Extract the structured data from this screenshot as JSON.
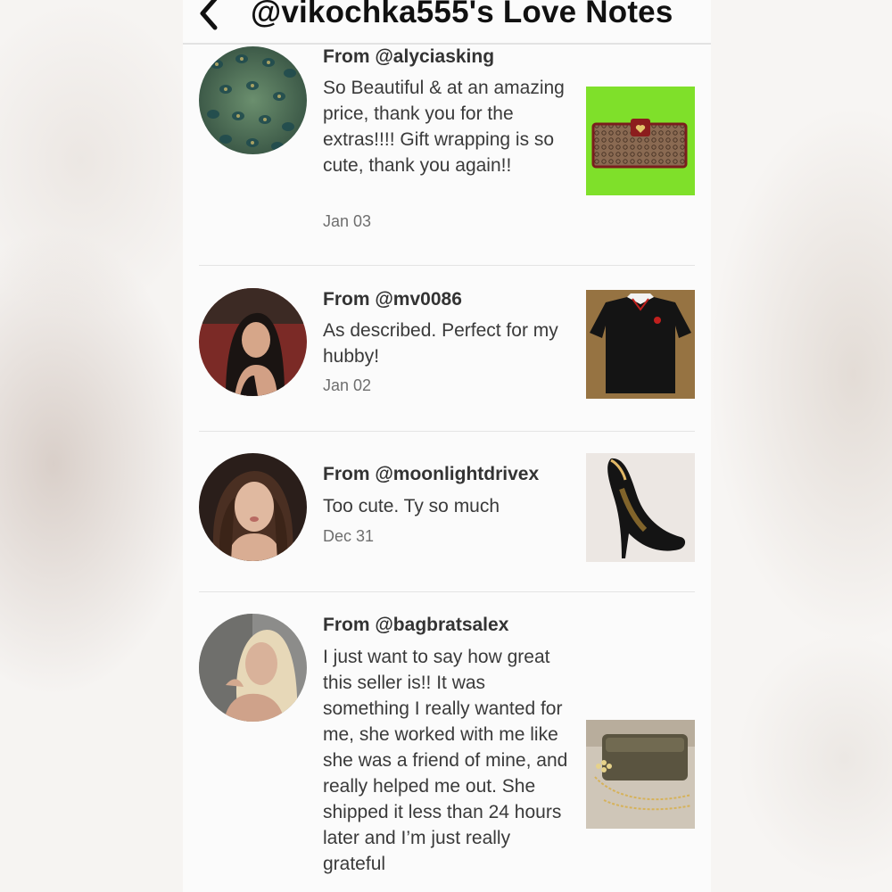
{
  "header": {
    "title": "@vikochka555's Love Notes"
  },
  "notes": [
    {
      "from": "From @alyciasking",
      "message": "So Beautiful & at an amazing price, thank you for the extras!!!! Gift wrapping is so cute, thank you again!!",
      "date": "Jan 03"
    },
    {
      "from": "From @mv0086",
      "message": "As described. Perfect for my hubby!",
      "date": "Jan 02"
    },
    {
      "from": "From @moonlightdrivex",
      "message": "Too cute. Ty so much",
      "date": "Dec 31"
    },
    {
      "from": "From @bagbratsalex",
      "message": "I just want to say how great this seller is!! It was something I really wanted for me, she worked with me like she was a friend of mine, and really helped me out. She shipped it less than 24 hours later and I’m just really grateful"
    }
  ],
  "icons": {
    "back": "chevron-left-icon"
  },
  "colors": {
    "background": "#fbfbfb",
    "title": "#111111",
    "text": "#3a3a3a",
    "date": "#6e6e6e",
    "divider": "#e4e4e4"
  }
}
